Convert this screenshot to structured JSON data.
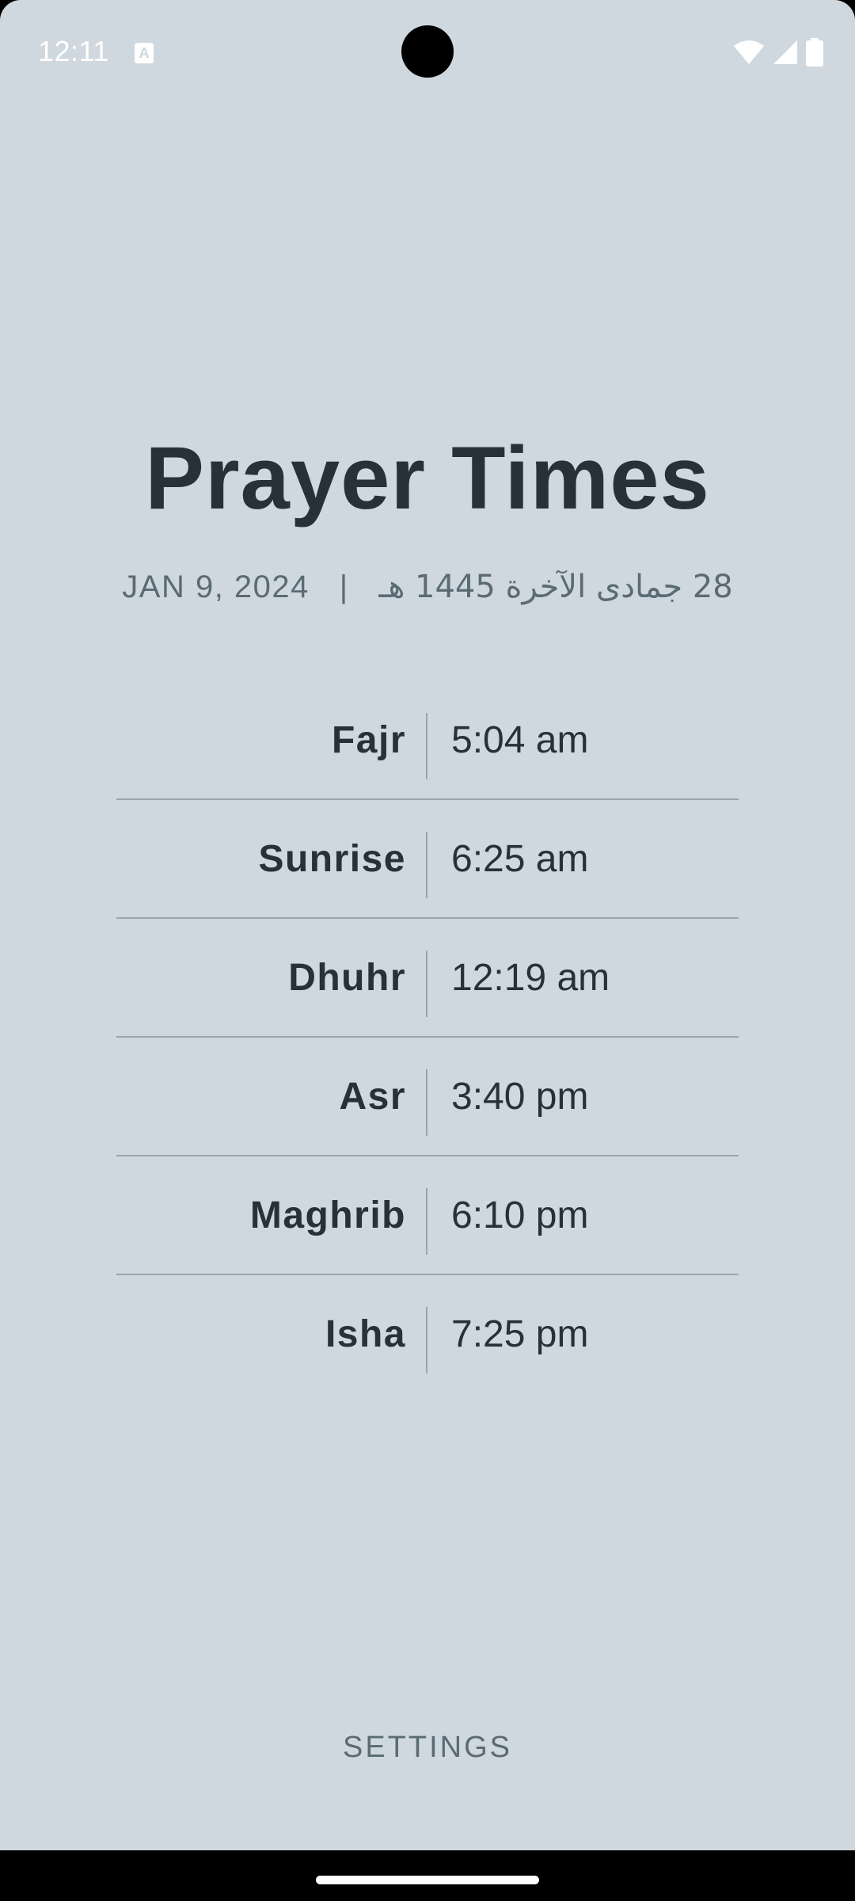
{
  "status_bar": {
    "time": "12:11",
    "notification_icon": "keyboard-a-icon",
    "notification_glyph": "A",
    "icons": [
      "wifi-icon",
      "signal-icon",
      "battery-icon"
    ]
  },
  "header": {
    "title": "Prayer Times",
    "gregorian_date": "JAN 9, 2024",
    "separator": "|",
    "hijri_date": "28 جمادى الآخرة 1445 هـ"
  },
  "prayers": [
    {
      "name": "Fajr",
      "time": "5:04 am"
    },
    {
      "name": "Sunrise",
      "time": "6:25 am"
    },
    {
      "name": "Dhuhr",
      "time": "12:19 am"
    },
    {
      "name": "Asr",
      "time": "3:40 pm"
    },
    {
      "name": "Maghrib",
      "time": "6:10 pm"
    },
    {
      "name": "Isha",
      "time": "7:25 pm"
    }
  ],
  "footer": {
    "settings_label": "SETTINGS"
  },
  "colors": {
    "background": "#cfd8de",
    "text_primary": "#263238",
    "text_secondary": "#5b6b75",
    "divider": "#98a6ae"
  }
}
